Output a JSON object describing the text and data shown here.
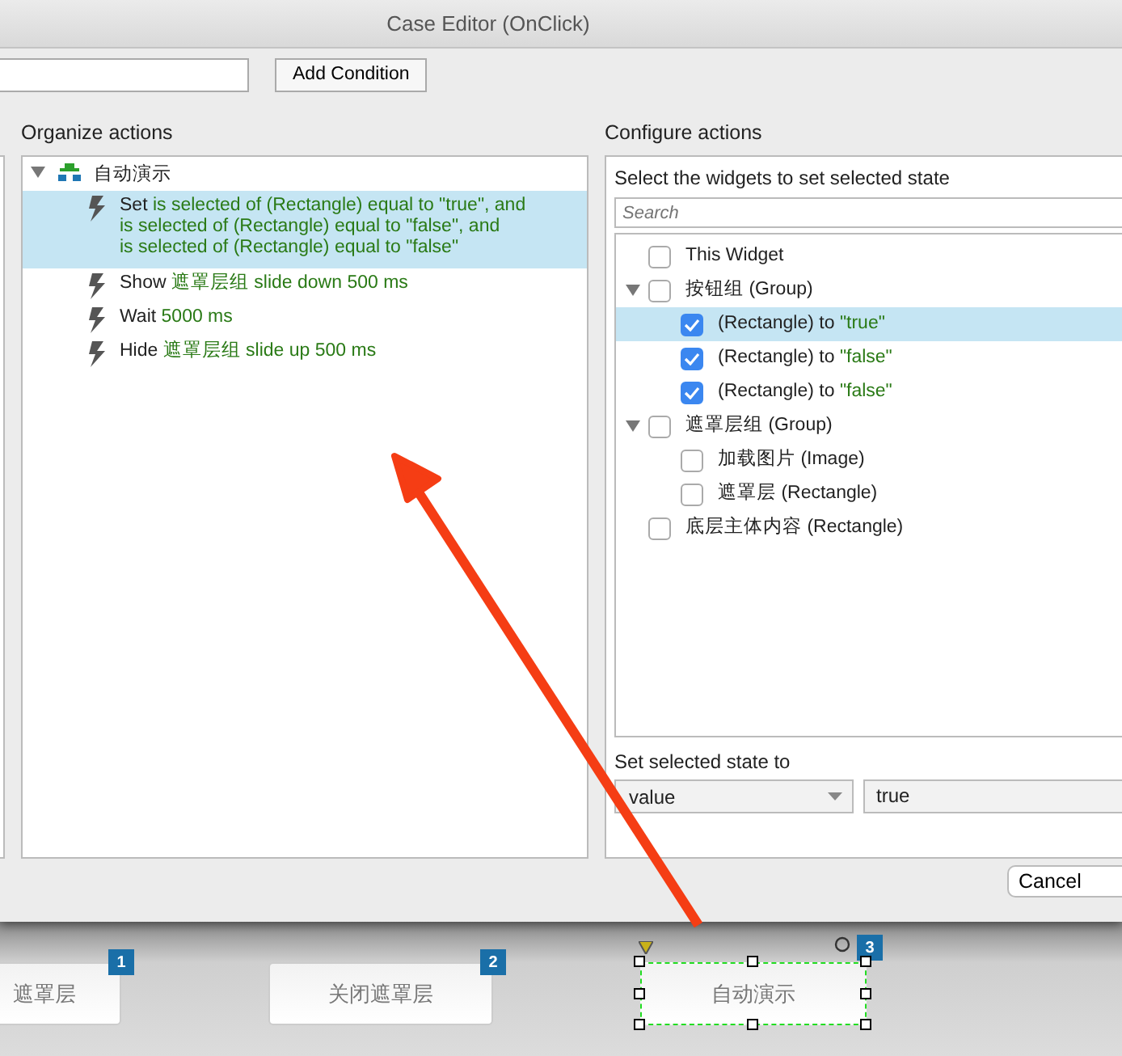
{
  "window": {
    "title": "Case Editor (OnClick)"
  },
  "condition": {
    "button": "Add Condition"
  },
  "organize": {
    "heading": "Organize actions",
    "case": {
      "label": "自动演示",
      "expanded": true
    },
    "actions": [
      {
        "verb": "Set",
        "lines": [
          "is selected of (Rectangle) equal to \"true\", and",
          "is selected of (Rectangle) equal to \"false\", and",
          "is selected of (Rectangle) equal to \"false\""
        ],
        "selected": true
      },
      {
        "verb": "Show",
        "lines": [
          "遮罩层组 slide down 500 ms"
        ],
        "selected": false
      },
      {
        "verb": "Wait",
        "lines": [
          "5000 ms"
        ],
        "selected": false
      },
      {
        "verb": "Hide",
        "lines": [
          "遮罩层组 slide up 500 ms"
        ],
        "selected": false
      }
    ]
  },
  "configure": {
    "heading": "Configure actions",
    "subheading": "Select the widgets to set selected state",
    "search": {
      "placeholder": "Search"
    },
    "widgets": [
      {
        "label": "This Widget",
        "checked": false,
        "selected": false
      },
      {
        "label": "按钮组 (Group)",
        "checked": false,
        "selected": false,
        "expanded": true,
        "children": [
          {
            "label": "(Rectangle) to ",
            "value": "\"true\"",
            "checked": true,
            "selected": true
          },
          {
            "label": "(Rectangle) to ",
            "value": "\"false\"",
            "checked": true,
            "selected": false
          },
          {
            "label": "(Rectangle) to ",
            "value": "\"false\"",
            "checked": true,
            "selected": false
          }
        ]
      },
      {
        "label": "遮罩层组 (Group)",
        "checked": false,
        "selected": false,
        "expanded": true,
        "children": [
          {
            "label": "加载图片 (Image)",
            "checked": false,
            "selected": false
          },
          {
            "label": "遮罩层 (Rectangle)",
            "checked": false,
            "selected": false
          }
        ]
      },
      {
        "label": "底层主体内容 (Rectangle)",
        "checked": false,
        "selected": false
      }
    ],
    "state": {
      "label": "Set selected state to",
      "select": "value",
      "value": "true"
    }
  },
  "footer": {
    "button": "Cancel"
  },
  "canvas": {
    "buttons": [
      {
        "label": "遮罩层",
        "badge": "1",
        "selected": false
      },
      {
        "label": "关闭遮罩层",
        "badge": "2",
        "selected": false
      },
      {
        "label": "自动演示",
        "badge": "3",
        "selected": true
      }
    ]
  },
  "annotations": [
    {
      "kind": "arrow"
    }
  ]
}
